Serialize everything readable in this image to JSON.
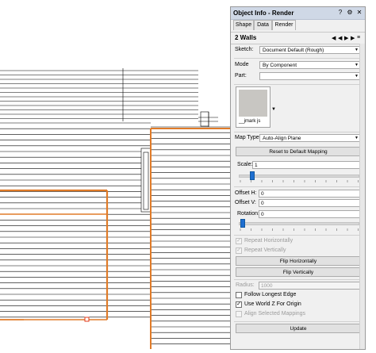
{
  "palette": {
    "title": "Object Info - Render",
    "title_buttons": [
      "?",
      "⚙",
      "✕"
    ],
    "tabs": [
      "Shape",
      "Data",
      "Render"
    ],
    "active_tab": "Render",
    "object_name": "2 Walls",
    "sketch_label": "Sketch:",
    "sketch_value": "Document Default (Rough)",
    "mode_label": "Mode",
    "mode_value": "By Component",
    "part_label": "Part:",
    "part_value": "",
    "texture_name": "__jmark js",
    "map_type_label": "Map Type:",
    "map_type_value": "Auto-Align Plane",
    "reset_button": "Reset to Default Mapping",
    "scale_label": "Scale:",
    "scale_value": "1",
    "offset_h_label": "Offset H:",
    "offset_h_value": "0",
    "offset_v_label": "Offset V:",
    "offset_v_value": "0",
    "rotation_label": "Rotation:",
    "rotation_value": "0",
    "repeat_h_label": "Repeat Horizontally",
    "repeat_v_label": "Repeat Vertically",
    "flip_h_button": "Flip Horizontally",
    "flip_v_button": "Flip Vertically",
    "radius_label": "Radius:",
    "radius_value": "1000",
    "follow_edge_label": "Follow Longest Edge",
    "world_z_label": "Use World Z For Origin",
    "align_mappings_label": "Align Selected Mappings",
    "update_button": "Update"
  },
  "colors": {
    "wall_highlight": "#e07b28",
    "selection": "#e03a1a",
    "lines": "#000000"
  }
}
